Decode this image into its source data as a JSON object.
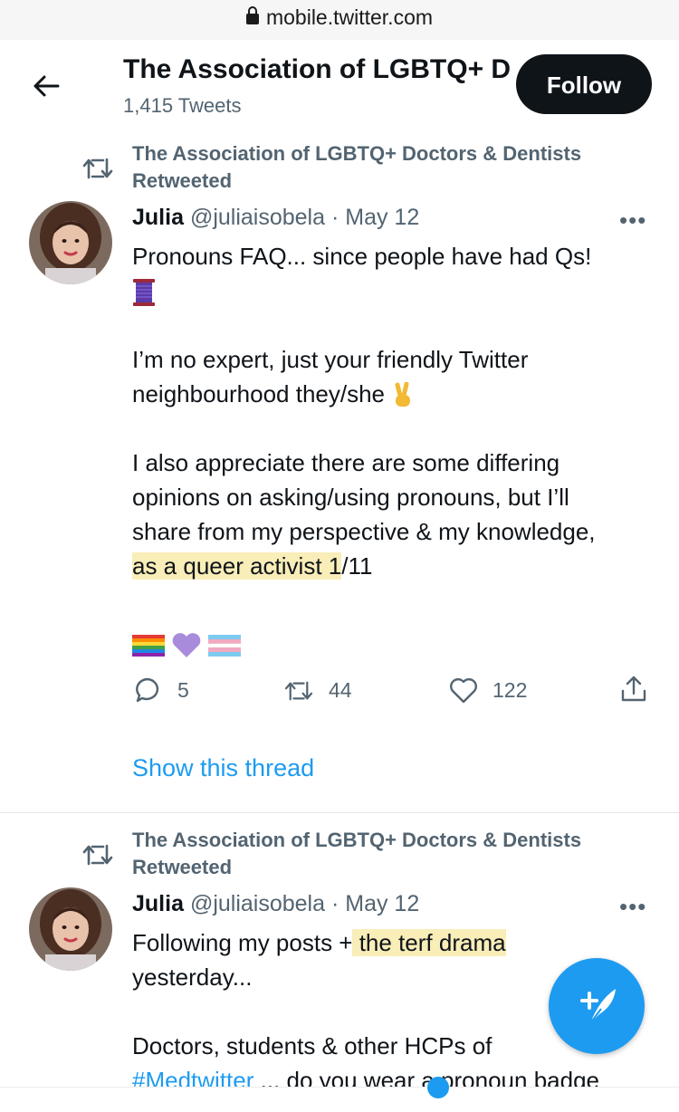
{
  "browser": {
    "url": "mobile.twitter.com"
  },
  "profile_header": {
    "title": "The Association of LGBTQ+ D",
    "tweet_count": "1,415 Tweets",
    "follow_label": "Follow"
  },
  "tweets": [
    {
      "retweeted_by": "The Association of LGBTQ+ Doctors & Dentists Retweeted",
      "author_name": "Julia",
      "handle": "@juliaisobela",
      "separator": "·",
      "date": "May 12",
      "more_label": "•••",
      "lines": {
        "l1": "Pronouns FAQ... since people have had Qs!",
        "p2a": "I’m no expert, just your friendly Twitter",
        "p2b": "neighbourhood they/she",
        "p3a": "I also appreciate there are some differing",
        "p3b": "opinions on asking/using pronouns, but I’ll",
        "p3c": "share from my perspective & my knowledge,",
        "p3d_hl": "as a queer activist 1",
        "p3d_rest": "/11"
      },
      "emojis": [
        "thread-spool",
        "victory-hand",
        "rainbow-flag",
        "purple-heart",
        "transgender-flag"
      ],
      "actions": {
        "replies": "5",
        "retweets": "44",
        "likes": "122"
      },
      "show_thread": "Show this thread"
    },
    {
      "retweeted_by": "The Association of LGBTQ+ Doctors & Dentists Retweeted",
      "author_name": "Julia",
      "handle": "@juliaisobela",
      "separator": "·",
      "date": "May 12",
      "more_label": "•••",
      "lines": {
        "l1a": "Following my posts +",
        "l1hl": " the terf drama",
        "l2": "yesterday...",
        "l3": "Doctors, students & other HCPs of",
        "l4link": "#Medtwitter",
        "l4rest": " ... do you wear a pronoun badge"
      }
    }
  ],
  "fab": {
    "icon": "compose-tweet-icon"
  },
  "colors": {
    "accent": "#1d9bf0",
    "text": "#0f1419",
    "muted": "#536471",
    "highlight": "#f9edb8"
  }
}
